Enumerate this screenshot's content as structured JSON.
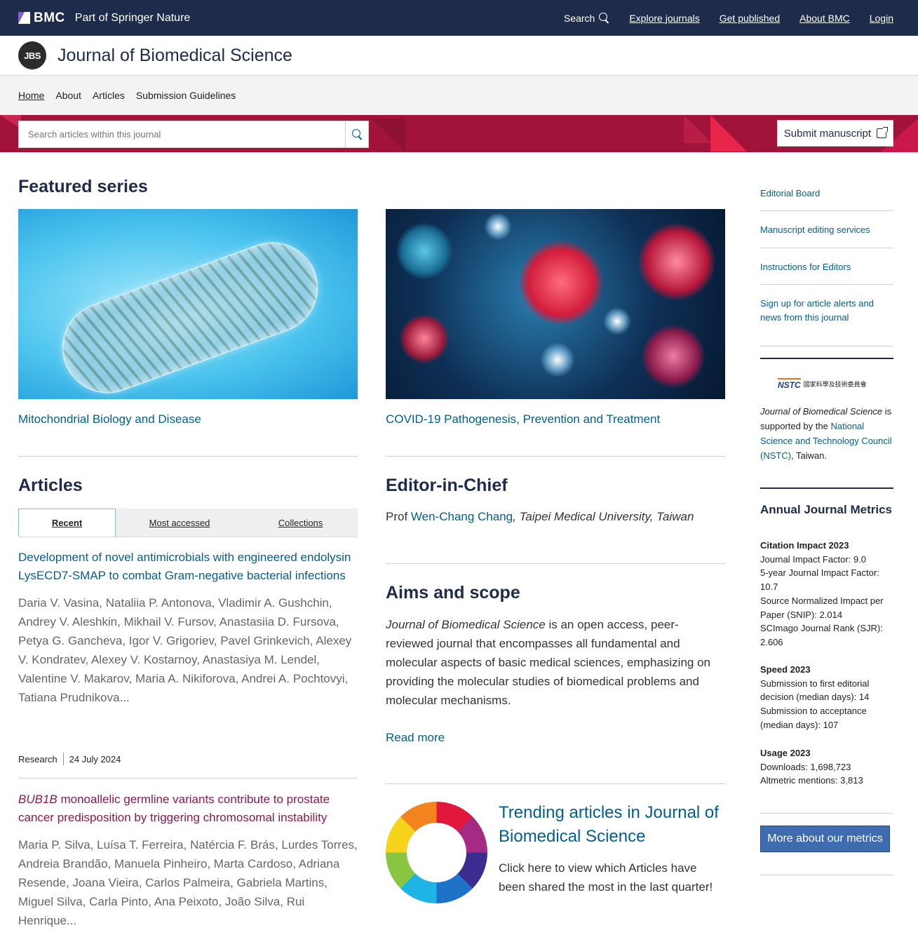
{
  "topbar": {
    "brand": "BMC",
    "brand_sub": "Part of Springer Nature",
    "search_label": "Search",
    "links": [
      "Explore journals",
      "Get published",
      "About BMC",
      "Login"
    ]
  },
  "journal": {
    "logo_text": "JBS",
    "title": "Journal of Biomedical Science"
  },
  "subnav": [
    "Home",
    "About",
    "Articles",
    "Submission Guidelines"
  ],
  "banner": {
    "search_placeholder": "Search articles within this journal",
    "submit_label": "Submit manuscript"
  },
  "featured": {
    "title": "Featured series",
    "items": [
      {
        "caption": "Mitochondrial Biology and Disease"
      },
      {
        "caption": "COVID-19 Pathogenesis, Prevention and Treatment"
      }
    ]
  },
  "articles": {
    "title": "Articles",
    "tabs": [
      "Recent",
      "Most accessed",
      "Collections"
    ],
    "items": [
      {
        "title": "Development of novel antimicrobials with engineered endolysin LysECD7-SMAP to combat Gram-negative bacterial infections",
        "authors": "Daria V. Vasina, Nataliia P. Antonova, Vladimir A. Gushchin, Andrey V. Aleshkin, Mikhail V. Fursov, Anastasiia D. Fursova, Petya G. Gancheva, Igor V. Grigoriev, Pavel Grinkevich, Alexey V. Kondratev, Alexey V. Kostarnoy, Anastasiya M. Lendel, Valentine V. Makarov, Maria A. Nikiforova, Andrei A. Pochtovyi, Tatiana Prudnikova...",
        "type": "Research",
        "date": "24 July 2024"
      },
      {
        "title_italic": "BUB1B",
        "title": " monoallelic germline variants contribute to prostate cancer predisposition by triggering chromosomal instability",
        "authors": "Maria P. Silva, Luísa T. Ferreira, Natércia F. Brás, Lurdes Torres, Andreia Brandão, Manuela Pinheiro, Marta Cardoso, Adriana Resende, Joana Vieira, Carlos Palmeira, Gabriela Martins, Miguel Silva, Carla Pinto, Ana Peixoto, João Silva, Rui Henrique..."
      }
    ]
  },
  "eic": {
    "title": "Editor-in-Chief",
    "prefix": "Prof ",
    "name": "Wen-Chang Chang",
    "affiliation": ", Taipei Medical University, Taiwan"
  },
  "aims": {
    "title": "Aims and scope",
    "journal_name": "Journal of Biomedical Science",
    "text": " is an open access, peer-reviewed journal that encompasses all fundamental and molecular aspects of basic medical sciences, emphasizing on providing the molecular studies of biomedical problems and molecular mechanisms.",
    "read_more": "Read more"
  },
  "trending": {
    "title": "Trending articles in Journal of Biomedical Science",
    "text": "Click here to view which Articles have been shared the most in the last quarter!"
  },
  "sidebar": {
    "links": [
      "Editorial Board",
      "Manuscript editing services",
      "Instructions for Editors",
      "Sign up for article alerts and news from this journal"
    ],
    "nstc_logo": "NSTC",
    "nstc_logo_sub": "國家科學及技術委員會",
    "nstc_journal": "Journal of Biomedical Science",
    "nstc_supported": " is supported by the ",
    "nstc_link": "National Science and Technology Council (NSTC)",
    "nstc_suffix": ", Taiwan.",
    "metrics_title": "Annual Journal Metrics",
    "citation_title": "Citation Impact 2023",
    "citation_lines": [
      "Journal Impact Factor: 9.0",
      "5-year Journal Impact Factor: 10.7",
      "Source Normalized Impact per Paper (SNIP): 2.014",
      "SCImago Journal Rank (SJR): 2.606"
    ],
    "speed_title": "Speed 2023",
    "speed_lines": [
      "Submission to first editorial decision (median days): 14",
      "Submission to acceptance (median days): 107"
    ],
    "usage_title": "Usage 2023",
    "usage_lines": [
      "Downloads: 1,698,723",
      "Altmetric mentions: 3,813"
    ],
    "metrics_button": "More about our metrics"
  }
}
